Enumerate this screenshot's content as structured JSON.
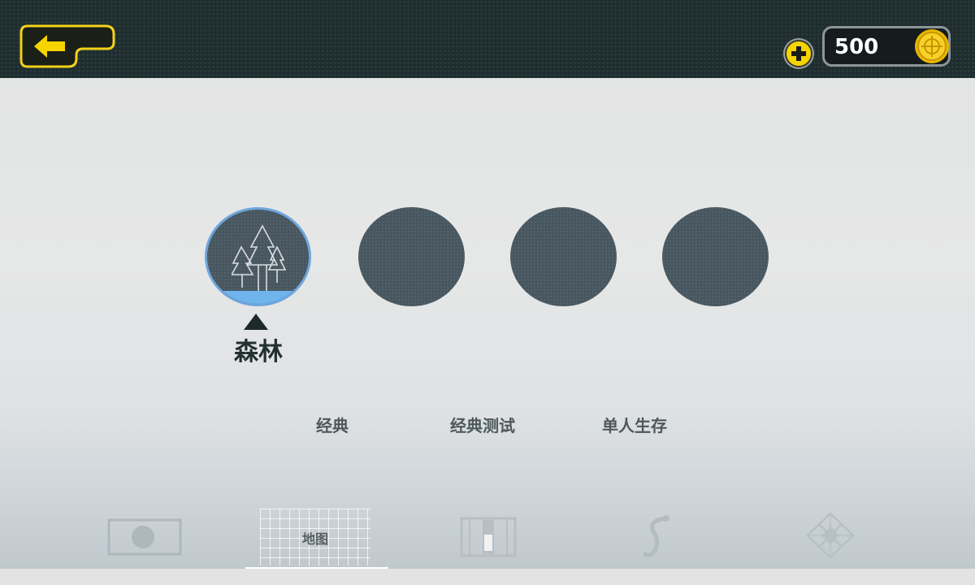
{
  "header": {
    "coins": "500",
    "colors": {
      "bar": "#1f2d2f",
      "accent": "#f5d400"
    },
    "icons": {
      "back": "back-arrow-icon",
      "plus": "plus-icon",
      "coin": "gold-coin-icon"
    }
  },
  "maps": {
    "items": [
      {
        "id": "forest",
        "name": "森林",
        "selected": true,
        "icon": "forest-trees-icon"
      },
      {
        "id": "locked-2",
        "name": "",
        "selected": false
      },
      {
        "id": "locked-3",
        "name": "",
        "selected": false
      },
      {
        "id": "locked-4",
        "name": "",
        "selected": false
      }
    ],
    "selected_name": "森林",
    "selected_color": "#6ea6dc"
  },
  "modes": {
    "items": [
      {
        "label": "经典"
      },
      {
        "label": "经典测试"
      },
      {
        "label": "单人生存"
      }
    ]
  },
  "bottom_nav": {
    "active_tab": "地图",
    "tabs": [
      {
        "icon": "screen-circle-icon"
      },
      {
        "label": "地图"
      },
      {
        "icon": "door-panel-icon"
      },
      {
        "icon": "serpent-icon"
      },
      {
        "icon": "diamond-pattern-icon"
      }
    ]
  }
}
